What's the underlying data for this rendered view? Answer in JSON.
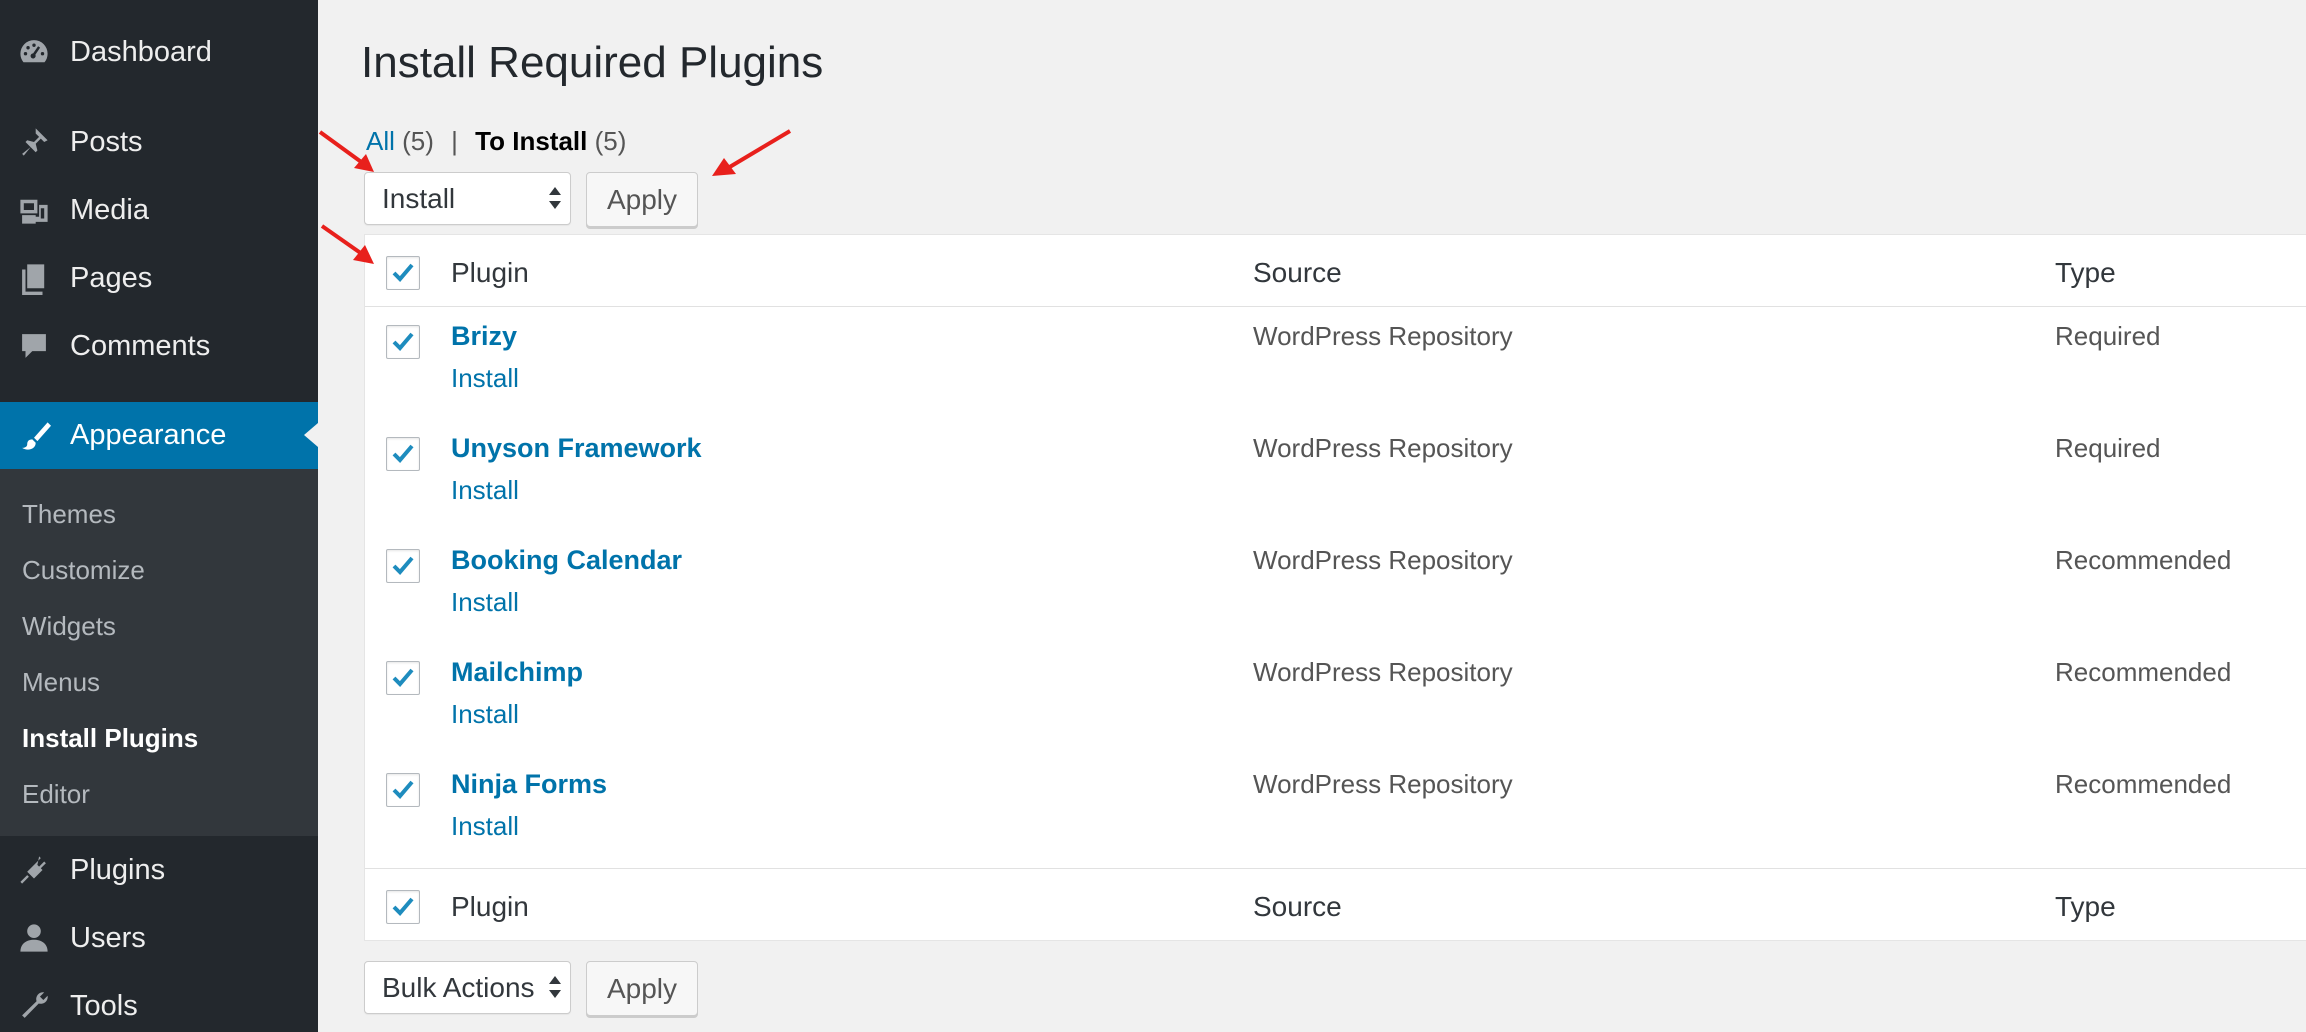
{
  "sidebar": {
    "items": [
      {
        "label": "Dashboard",
        "icon": "dashboard-icon"
      },
      {
        "label": "Posts",
        "icon": "pin-icon"
      },
      {
        "label": "Media",
        "icon": "media-icon"
      },
      {
        "label": "Pages",
        "icon": "pages-icon"
      },
      {
        "label": "Comments",
        "icon": "comment-icon"
      },
      {
        "label": "Appearance",
        "icon": "paintbrush-icon"
      },
      {
        "label": "Plugins",
        "icon": "plug-icon"
      },
      {
        "label": "Users",
        "icon": "user-icon"
      },
      {
        "label": "Tools",
        "icon": "wrench-icon"
      }
    ],
    "submenu": [
      "Themes",
      "Customize",
      "Widgets",
      "Menus",
      "Install Plugins",
      "Editor"
    ],
    "current_submenu": "Install Plugins"
  },
  "page": {
    "title": "Install Required Plugins"
  },
  "views": {
    "all_label": "All",
    "all_count": "(5)",
    "separator": "|",
    "to_install_label": "To Install",
    "to_install_count": "(5)"
  },
  "top_actions": {
    "selected": "Install",
    "apply_label": "Apply"
  },
  "bottom_actions": {
    "selected": "Bulk Actions",
    "apply_label": "Apply"
  },
  "table": {
    "columns": [
      "Plugin",
      "Source",
      "Type"
    ],
    "rows": [
      {
        "name": "Brizy",
        "action": "Install",
        "source": "WordPress Repository",
        "type": "Required",
        "checked": true
      },
      {
        "name": "Unyson Framework",
        "action": "Install",
        "source": "WordPress Repository",
        "type": "Required",
        "checked": true
      },
      {
        "name": "Booking Calendar",
        "action": "Install",
        "source": "WordPress Repository",
        "type": "Recommended",
        "checked": true
      },
      {
        "name": "Mailchimp",
        "action": "Install",
        "source": "WordPress Repository",
        "type": "Recommended",
        "checked": true
      },
      {
        "name": "Ninja Forms",
        "action": "Install",
        "source": "WordPress Repository",
        "type": "Recommended",
        "checked": true
      }
    ]
  },
  "colors": {
    "sidebar_bg": "#23282d",
    "submenu_bg": "#32373c",
    "accent": "#0073aa",
    "annotation_arrow": "#e8201c"
  }
}
